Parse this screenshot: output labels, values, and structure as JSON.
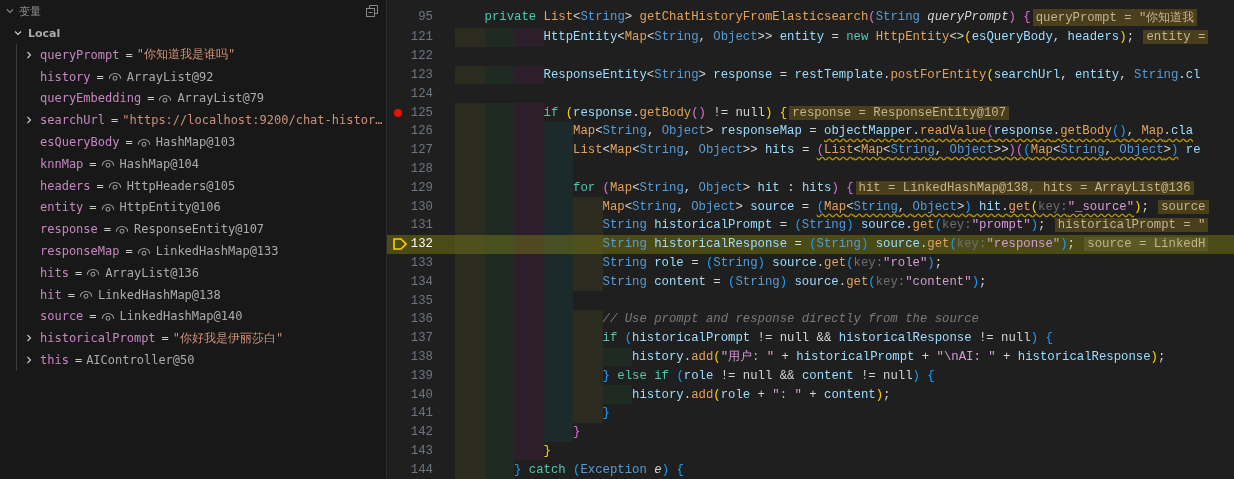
{
  "variables_panel": {
    "title": "变量",
    "scope": {
      "label": "Local",
      "expanded": true
    },
    "variables": [
      {
        "name": "queryPrompt",
        "operator": "=",
        "value": "\"你知道我是谁吗\"",
        "kind": "string",
        "expandable": true
      },
      {
        "name": "history",
        "operator": "=",
        "value": "ArrayList@92",
        "kind": "object",
        "expandable": false
      },
      {
        "name": "queryEmbedding",
        "operator": "=",
        "value": "ArrayList@79",
        "kind": "object",
        "expandable": false
      },
      {
        "name": "searchUrl",
        "operator": "=",
        "value": "\"https://localhost:9200/chat-histor…",
        "kind": "string",
        "expandable": true
      },
      {
        "name": "esQueryBody",
        "operator": "=",
        "value": "HashMap@103",
        "kind": "object",
        "expandable": false
      },
      {
        "name": "knnMap",
        "operator": "=",
        "value": "HashMap@104",
        "kind": "object",
        "expandable": false
      },
      {
        "name": "headers",
        "operator": "=",
        "value": "HttpHeaders@105",
        "kind": "object",
        "expandable": false
      },
      {
        "name": "entity",
        "operator": "=",
        "value": "HttpEntity@106",
        "kind": "object",
        "expandable": false
      },
      {
        "name": "response",
        "operator": "=",
        "value": "ResponseEntity@107",
        "kind": "object",
        "expandable": false
      },
      {
        "name": "responseMap",
        "operator": "=",
        "value": "LinkedHashMap@133",
        "kind": "object",
        "expandable": false
      },
      {
        "name": "hits",
        "operator": "=",
        "value": "ArrayList@136",
        "kind": "object",
        "expandable": false
      },
      {
        "name": "hit",
        "operator": "=",
        "value": "LinkedHashMap@138",
        "kind": "object",
        "expandable": false
      },
      {
        "name": "source",
        "operator": "=",
        "value": "LinkedHashMap@140",
        "kind": "object",
        "expandable": false
      },
      {
        "name": "historicalPrompt",
        "operator": "=",
        "value": "\"你好我是伊丽莎白\"",
        "kind": "string",
        "expandable": true
      },
      {
        "name": "this",
        "operator": "=",
        "value": "AIController@50",
        "kind": "plain",
        "expandable": true
      }
    ]
  },
  "editor": {
    "sticky_line": {
      "number": "95",
      "tokens": [
        {
          "kind": "kw",
          "text": "    private "
        },
        {
          "kind": "generic",
          "text": "List"
        },
        {
          "kind": "plain",
          "text": "<"
        },
        {
          "kind": "type",
          "text": "String"
        },
        {
          "kind": "plain",
          "text": "> "
        },
        {
          "kind": "fn",
          "text": "getChatHistoryFromElasticsearch"
        },
        {
          "kind": "b2",
          "text": "("
        },
        {
          "kind": "type",
          "text": "String "
        },
        {
          "kind": "param",
          "text": "queryPrompt"
        },
        {
          "kind": "b2",
          "text": ") {"
        }
      ],
      "inline": "queryPrompt = \"你知道我"
    },
    "lines": [
      {
        "number": "121",
        "breakpoint": false,
        "current": false,
        "guides": [
          {
            "color": "#2b2b1f"
          },
          {
            "color": "#1f2a22"
          },
          {
            "color": "#2c1f2b"
          }
        ],
        "tokens": [
          {
            "kind": "var",
            "text": "HttpEntity"
          },
          {
            "kind": "plain",
            "text": "<"
          },
          {
            "kind": "generic",
            "text": "Map"
          },
          {
            "kind": "plain",
            "text": "<"
          },
          {
            "kind": "type",
            "text": "String"
          },
          {
            "kind": "plain",
            "text": ", "
          },
          {
            "kind": "type",
            "text": "Object"
          },
          {
            "kind": "plain",
            "text": ">> "
          },
          {
            "kind": "var",
            "text": "entity"
          },
          {
            "kind": "plain",
            "text": " = "
          },
          {
            "kind": "kw",
            "text": "new "
          },
          {
            "kind": "fn",
            "text": "HttpEntity"
          },
          {
            "kind": "plain",
            "text": "<>"
          },
          {
            "kind": "b1",
            "text": "("
          },
          {
            "kind": "var",
            "text": "esQueryBody"
          },
          {
            "kind": "plain",
            "text": ", "
          },
          {
            "kind": "var",
            "text": "headers"
          },
          {
            "kind": "b1",
            "text": ")"
          },
          {
            "kind": "plain",
            "text": "; "
          }
        ],
        "inline": "entity ="
      },
      {
        "number": "122",
        "breakpoint": false,
        "current": false
      },
      {
        "number": "123",
        "breakpoint": false,
        "current": false,
        "guides": [
          {
            "color": "#2b2b1f"
          },
          {
            "color": "#1f2a22"
          },
          {
            "color": "#2c1f2b"
          }
        ],
        "tokens": [
          {
            "kind": "var",
            "text": "ResponseEntity"
          },
          {
            "kind": "plain",
            "text": "<"
          },
          {
            "kind": "type",
            "text": "String"
          },
          {
            "kind": "plain",
            "text": "> "
          },
          {
            "kind": "var",
            "text": "response"
          },
          {
            "kind": "plain",
            "text": " = "
          },
          {
            "kind": "var",
            "text": "restTemplate"
          },
          {
            "kind": "plain",
            "text": "."
          },
          {
            "kind": "fn",
            "text": "postForEntity"
          },
          {
            "kind": "b1",
            "text": "("
          },
          {
            "kind": "var",
            "text": "searchUrl"
          },
          {
            "kind": "plain",
            "text": ", "
          },
          {
            "kind": "var",
            "text": "entity"
          },
          {
            "kind": "plain",
            "text": ", "
          },
          {
            "kind": "type",
            "text": "String"
          },
          {
            "kind": "plain",
            "text": "."
          },
          {
            "kind": "var",
            "text": "cl"
          }
        ]
      },
      {
        "number": "124",
        "breakpoint": false,
        "current": false
      },
      {
        "number": "125",
        "breakpoint": true,
        "current": false,
        "guides": [
          {
            "color": "#2b2b1f"
          },
          {
            "color": "#1f2a22"
          },
          {
            "color": "#2c1f2b"
          }
        ],
        "tokens": [
          {
            "kind": "kw",
            "text": "if "
          },
          {
            "kind": "b1",
            "text": "("
          },
          {
            "kind": "var",
            "text": "response"
          },
          {
            "kind": "plain",
            "text": "."
          },
          {
            "kind": "fn",
            "text": "getBody"
          },
          {
            "kind": "b2",
            "text": "()"
          },
          {
            "kind": "plain",
            "text": " != null"
          },
          {
            "kind": "b1",
            "text": ") {"
          }
        ],
        "inline": "response = ResponseEntity@107"
      },
      {
        "number": "126",
        "breakpoint": false,
        "current": false,
        "guides": [
          {
            "color": "#2b2b1f"
          },
          {
            "color": "#1f2a22"
          },
          {
            "color": "#2c1f2b"
          },
          {
            "color": "#1d2a2b"
          }
        ],
        "tokens": [
          {
            "kind": "generic",
            "text": "Map"
          },
          {
            "kind": "plain",
            "text": "<"
          },
          {
            "kind": "type",
            "text": "String"
          },
          {
            "kind": "plain",
            "text": ", "
          },
          {
            "kind": "type",
            "text": "Object"
          },
          {
            "kind": "plain",
            "text": "> "
          },
          {
            "kind": "var",
            "text": "responseMap"
          },
          {
            "kind": "plain",
            "text": " = "
          },
          {
            "kind": "var",
            "text": "objectMapper",
            "warn": true
          },
          {
            "kind": "plain",
            "text": ".",
            "warn": true
          },
          {
            "kind": "fn",
            "text": "readValue",
            "warn": true
          },
          {
            "kind": "b2",
            "text": "(",
            "warn": true
          },
          {
            "kind": "var",
            "text": "response",
            "warn": true
          },
          {
            "kind": "plain",
            "text": ".",
            "warn": true
          },
          {
            "kind": "fn",
            "text": "getBody",
            "warn": true
          },
          {
            "kind": "b3",
            "text": "()",
            "warn": true
          },
          {
            "kind": "plain",
            "text": ", ",
            "warn": true
          },
          {
            "kind": "generic",
            "text": "Map",
            "warn": true
          },
          {
            "kind": "plain",
            "text": ".",
            "warn": true
          },
          {
            "kind": "var",
            "text": "cla",
            "warn": true
          }
        ]
      },
      {
        "number": "127",
        "breakpoint": false,
        "current": false,
        "guides": [
          {
            "color": "#2b2b1f"
          },
          {
            "color": "#1f2a22"
          },
          {
            "color": "#2c1f2b"
          },
          {
            "color": "#1d2a2b"
          }
        ],
        "tokens": [
          {
            "kind": "generic",
            "text": "List"
          },
          {
            "kind": "plain",
            "text": "<"
          },
          {
            "kind": "generic",
            "text": "Map"
          },
          {
            "kind": "plain",
            "text": "<"
          },
          {
            "kind": "type",
            "text": "String"
          },
          {
            "kind": "plain",
            "text": ", "
          },
          {
            "kind": "type",
            "text": "Object"
          },
          {
            "kind": "plain",
            "text": ">> "
          },
          {
            "kind": "var",
            "text": "hits"
          },
          {
            "kind": "plain",
            "text": " = "
          },
          {
            "kind": "b2",
            "text": "(",
            "warn": true
          },
          {
            "kind": "generic",
            "text": "List",
            "warn": true
          },
          {
            "kind": "plain",
            "text": "<",
            "warn": true
          },
          {
            "kind": "generic",
            "text": "Map",
            "warn": true
          },
          {
            "kind": "plain",
            "text": "<",
            "warn": true
          },
          {
            "kind": "type",
            "text": "String",
            "warn": true
          },
          {
            "kind": "plain",
            "text": ", ",
            "warn": true
          },
          {
            "kind": "type",
            "text": "Object",
            "warn": true
          },
          {
            "kind": "plain",
            "text": ">>",
            "warn": true
          },
          {
            "kind": "b2",
            "text": ")(",
            "warn": true
          },
          {
            "kind": "b3",
            "text": "(",
            "warn": true
          },
          {
            "kind": "generic",
            "text": "Map",
            "warn": true
          },
          {
            "kind": "plain",
            "text": "<",
            "warn": true
          },
          {
            "kind": "type",
            "text": "String",
            "warn": true
          },
          {
            "kind": "plain",
            "text": ", ",
            "warn": true
          },
          {
            "kind": "type",
            "text": "Object",
            "warn": true
          },
          {
            "kind": "plain",
            "text": ">",
            "warn": true
          },
          {
            "kind": "b3",
            "text": ")",
            "warn": true
          },
          {
            "kind": "var",
            "text": " re"
          }
        ]
      },
      {
        "number": "128",
        "breakpoint": false,
        "current": false,
        "guides": [
          {
            "color": "#2b2b1f"
          },
          {
            "color": "#1f2a22"
          },
          {
            "color": "#2c1f2b"
          },
          {
            "color": "#1d2a2b"
          }
        ]
      },
      {
        "number": "129",
        "breakpoint": false,
        "current": false,
        "guides": [
          {
            "color": "#2b2b1f"
          },
          {
            "color": "#1f2a22"
          },
          {
            "color": "#2c1f2b"
          },
          {
            "color": "#1d2a2b"
          }
        ],
        "tokens": [
          {
            "kind": "kw",
            "text": "for "
          },
          {
            "kind": "b2",
            "text": "("
          },
          {
            "kind": "generic",
            "text": "Map"
          },
          {
            "kind": "plain",
            "text": "<"
          },
          {
            "kind": "type",
            "text": "String"
          },
          {
            "kind": "plain",
            "text": ", "
          },
          {
            "kind": "type",
            "text": "Object"
          },
          {
            "kind": "plain",
            "text": "> "
          },
          {
            "kind": "var",
            "text": "hit"
          },
          {
            "kind": "plain",
            "text": " : "
          },
          {
            "kind": "var",
            "text": "hits"
          },
          {
            "kind": "b2",
            "text": ") {"
          }
        ],
        "inline": "hit = LinkedHashMap@138, hits = ArrayList@136"
      },
      {
        "number": "130",
        "breakpoint": false,
        "current": false,
        "guides": [
          {
            "color": "#2b2b1f"
          },
          {
            "color": "#1f2a22"
          },
          {
            "color": "#2c1f2b"
          },
          {
            "color": "#1d2a2b"
          },
          {
            "color": "#2b2b1f"
          }
        ],
        "tokens": [
          {
            "kind": "generic",
            "text": "Map"
          },
          {
            "kind": "plain",
            "text": "<"
          },
          {
            "kind": "type",
            "text": "String"
          },
          {
            "kind": "plain",
            "text": ", "
          },
          {
            "kind": "type",
            "text": "Object"
          },
          {
            "kind": "plain",
            "text": "> "
          },
          {
            "kind": "var",
            "text": "source"
          },
          {
            "kind": "plain",
            "text": " = "
          },
          {
            "kind": "b3",
            "text": "(",
            "warn": true
          },
          {
            "kind": "generic",
            "text": "Map",
            "warn": true
          },
          {
            "kind": "plain",
            "text": "<",
            "warn": true
          },
          {
            "kind": "type",
            "text": "String",
            "warn": true
          },
          {
            "kind": "plain",
            "text": ", ",
            "warn": true
          },
          {
            "kind": "type",
            "text": "Object",
            "warn": true
          },
          {
            "kind": "plain",
            "text": ">",
            "warn": true
          },
          {
            "kind": "b3",
            "text": ")",
            "warn": true
          },
          {
            "kind": "var",
            "text": " hit",
            "warn": true
          },
          {
            "kind": "plain",
            "text": ".",
            "warn": true
          },
          {
            "kind": "fn",
            "text": "get",
            "warn": true
          },
          {
            "kind": "b1",
            "text": "(",
            "warn": true
          },
          {
            "kind": "hint",
            "text": "key:",
            "warn": true
          },
          {
            "kind": "str",
            "text": "\"_source\"",
            "warn": true
          },
          {
            "kind": "b1",
            "text": ")"
          },
          {
            "kind": "plain",
            "text": "; "
          }
        ],
        "inline": "source"
      },
      {
        "number": "131",
        "breakpoint": false,
        "current": false,
        "guides": [
          {
            "color": "#2b2b1f"
          },
          {
            "color": "#1f2a22"
          },
          {
            "color": "#2c1f2b"
          },
          {
            "color": "#1d2a2b"
          },
          {
            "color": "#2b2b1f"
          }
        ],
        "tokens": [
          {
            "kind": "type",
            "text": "String "
          },
          {
            "kind": "var",
            "text": "historicalPrompt"
          },
          {
            "kind": "plain",
            "text": " = "
          },
          {
            "kind": "b3",
            "text": "("
          },
          {
            "kind": "type",
            "text": "String"
          },
          {
            "kind": "b3",
            "text": ")"
          },
          {
            "kind": "var",
            "text": " source"
          },
          {
            "kind": "plain",
            "text": "."
          },
          {
            "kind": "fn",
            "text": "get"
          },
          {
            "kind": "b3",
            "text": "("
          },
          {
            "kind": "hint",
            "text": "key:"
          },
          {
            "kind": "str",
            "text": "\"prompt\""
          },
          {
            "kind": "b3",
            "text": ")"
          },
          {
            "kind": "plain",
            "text": "; "
          }
        ],
        "inline": "historicalPrompt = \""
      },
      {
        "number": "132",
        "breakpoint": false,
        "current": true,
        "guides": [
          {
            "color": "#50501c"
          },
          {
            "color": "#48501e"
          },
          {
            "color": "#504820"
          },
          {
            "color": "#484f22"
          },
          {
            "color": "#50501c"
          }
        ],
        "tokens": [
          {
            "kind": "type",
            "text": "String "
          },
          {
            "kind": "var",
            "text": "historicalResponse"
          },
          {
            "kind": "plain",
            "text": " = "
          },
          {
            "kind": "b3",
            "text": "("
          },
          {
            "kind": "type",
            "text": "String"
          },
          {
            "kind": "b3",
            "text": ")"
          },
          {
            "kind": "var",
            "text": " source"
          },
          {
            "kind": "plain",
            "text": "."
          },
          {
            "kind": "fn",
            "text": "get"
          },
          {
            "kind": "b3",
            "text": "("
          },
          {
            "kind": "hint",
            "text": "key:"
          },
          {
            "kind": "str",
            "text": "\"response\""
          },
          {
            "kind": "b3",
            "text": ")"
          },
          {
            "kind": "plain",
            "text": "; "
          }
        ],
        "inline": "source = LinkedH"
      },
      {
        "number": "133",
        "breakpoint": false,
        "current": false,
        "guides": [
          {
            "color": "#2b2b1f"
          },
          {
            "color": "#1f2a22"
          },
          {
            "color": "#2c1f2b"
          },
          {
            "color": "#1d2a2b"
          },
          {
            "color": "#2b2b1f"
          }
        ],
        "tokens": [
          {
            "kind": "type",
            "text": "String "
          },
          {
            "kind": "var",
            "text": "role"
          },
          {
            "kind": "plain",
            "text": " = "
          },
          {
            "kind": "b3",
            "text": "("
          },
          {
            "kind": "type",
            "text": "String"
          },
          {
            "kind": "b3",
            "text": ")"
          },
          {
            "kind": "var",
            "text": " source"
          },
          {
            "kind": "plain",
            "text": "."
          },
          {
            "kind": "fn",
            "text": "get"
          },
          {
            "kind": "b3",
            "text": "("
          },
          {
            "kind": "hint",
            "text": "key:"
          },
          {
            "kind": "str",
            "text": "\"role\""
          },
          {
            "kind": "b3",
            "text": ")"
          },
          {
            "kind": "plain",
            "text": ";"
          }
        ]
      },
      {
        "number": "134",
        "breakpoint": false,
        "current": false,
        "guides": [
          {
            "color": "#2b2b1f"
          },
          {
            "color": "#1f2a22"
          },
          {
            "color": "#2c1f2b"
          },
          {
            "color": "#1d2a2b"
          },
          {
            "color": "#2b2b1f"
          }
        ],
        "tokens": [
          {
            "kind": "type",
            "text": "String "
          },
          {
            "kind": "var",
            "text": "content"
          },
          {
            "kind": "plain",
            "text": " = "
          },
          {
            "kind": "b3",
            "text": "("
          },
          {
            "kind": "type",
            "text": "String"
          },
          {
            "kind": "b3",
            "text": ")"
          },
          {
            "kind": "var",
            "text": " source"
          },
          {
            "kind": "plain",
            "text": "."
          },
          {
            "kind": "fn",
            "text": "get"
          },
          {
            "kind": "b3",
            "text": "("
          },
          {
            "kind": "hint",
            "text": "key:"
          },
          {
            "kind": "str",
            "text": "\"content\""
          },
          {
            "kind": "b3",
            "text": ")"
          },
          {
            "kind": "plain",
            "text": ";"
          }
        ]
      },
      {
        "number": "135",
        "breakpoint": false,
        "current": false,
        "guides": [
          {
            "color": "#2b2b1f"
          },
          {
            "color": "#1f2a22"
          },
          {
            "color": "#2c1f2b"
          },
          {
            "color": "#1d2a2b"
          }
        ]
      },
      {
        "number": "136",
        "breakpoint": false,
        "current": false,
        "guides": [
          {
            "color": "#2b2b1f"
          },
          {
            "color": "#1f2a22"
          },
          {
            "color": "#2c1f2b"
          },
          {
            "color": "#1d2a2b"
          },
          {
            "color": "#2b2b1f"
          }
        ],
        "tokens": [
          {
            "kind": "comment",
            "text": "// Use prompt and response directly from the source"
          }
        ]
      },
      {
        "number": "137",
        "breakpoint": false,
        "current": false,
        "guides": [
          {
            "color": "#2b2b1f"
          },
          {
            "color": "#1f2a22"
          },
          {
            "color": "#2c1f2b"
          },
          {
            "color": "#1d2a2b"
          },
          {
            "color": "#2b2b1f"
          }
        ],
        "tokens": [
          {
            "kind": "kw",
            "text": "if "
          },
          {
            "kind": "b3",
            "text": "("
          },
          {
            "kind": "var",
            "text": "historicalPrompt"
          },
          {
            "kind": "plain",
            "text": " != null && "
          },
          {
            "kind": "var",
            "text": "historicalResponse"
          },
          {
            "kind": "plain",
            "text": " != null"
          },
          {
            "kind": "b3",
            "text": ") {"
          }
        ]
      },
      {
        "number": "138",
        "breakpoint": false,
        "current": false,
        "guides": [
          {
            "color": "#2b2b1f"
          },
          {
            "color": "#1f2a22"
          },
          {
            "color": "#2c1f2b"
          },
          {
            "color": "#1d2a2b"
          },
          {
            "color": "#2b2b1f"
          },
          {
            "color": "#1f2a22"
          }
        ],
        "tokens": [
          {
            "kind": "var",
            "text": "history"
          },
          {
            "kind": "plain",
            "text": "."
          },
          {
            "kind": "fn",
            "text": "add"
          },
          {
            "kind": "b1",
            "text": "("
          },
          {
            "kind": "str",
            "text": "\"用户: \""
          },
          {
            "kind": "plain",
            "text": " + "
          },
          {
            "kind": "var",
            "text": "historicalPrompt"
          },
          {
            "kind": "plain",
            "text": " + "
          },
          {
            "kind": "str",
            "text": "\"\\nAI: \""
          },
          {
            "kind": "plain",
            "text": " + "
          },
          {
            "kind": "var",
            "text": "historicalResponse"
          },
          {
            "kind": "b1",
            "text": ")"
          },
          {
            "kind": "plain",
            "text": ";"
          }
        ]
      },
      {
        "number": "139",
        "breakpoint": false,
        "current": false,
        "guides": [
          {
            "color": "#2b2b1f"
          },
          {
            "color": "#1f2a22"
          },
          {
            "color": "#2c1f2b"
          },
          {
            "color": "#1d2a2b"
          },
          {
            "color": "#2b2b1f"
          }
        ],
        "tokens": [
          {
            "kind": "b3",
            "text": "}"
          },
          {
            "kind": "kw",
            "text": " else if "
          },
          {
            "kind": "b3",
            "text": "("
          },
          {
            "kind": "var",
            "text": "role"
          },
          {
            "kind": "plain",
            "text": " != null && "
          },
          {
            "kind": "var",
            "text": "content"
          },
          {
            "kind": "plain",
            "text": " != null"
          },
          {
            "kind": "b3",
            "text": ") {"
          }
        ]
      },
      {
        "number": "140",
        "breakpoint": false,
        "current": false,
        "guides": [
          {
            "color": "#2b2b1f"
          },
          {
            "color": "#1f2a22"
          },
          {
            "color": "#2c1f2b"
          },
          {
            "color": "#1d2a2b"
          },
          {
            "color": "#2b2b1f"
          },
          {
            "color": "#1f2a22"
          }
        ],
        "tokens": [
          {
            "kind": "var",
            "text": "history"
          },
          {
            "kind": "plain",
            "text": "."
          },
          {
            "kind": "fn",
            "text": "add"
          },
          {
            "kind": "b1",
            "text": "("
          },
          {
            "kind": "var",
            "text": "role"
          },
          {
            "kind": "plain",
            "text": " + "
          },
          {
            "kind": "str",
            "text": "\": \""
          },
          {
            "kind": "plain",
            "text": " + "
          },
          {
            "kind": "var",
            "text": "content"
          },
          {
            "kind": "b1",
            "text": ")"
          },
          {
            "kind": "plain",
            "text": ";"
          }
        ]
      },
      {
        "number": "141",
        "breakpoint": false,
        "current": false,
        "guides": [
          {
            "color": "#2b2b1f"
          },
          {
            "color": "#1f2a22"
          },
          {
            "color": "#2c1f2b"
          },
          {
            "color": "#1d2a2b"
          },
          {
            "color": "#2b2b1f"
          }
        ],
        "tokens": [
          {
            "kind": "b3",
            "text": "}"
          }
        ]
      },
      {
        "number": "142",
        "breakpoint": false,
        "current": false,
        "guides": [
          {
            "color": "#2b2b1f"
          },
          {
            "color": "#1f2a22"
          },
          {
            "color": "#2c1f2b"
          },
          {
            "color": "#1d2a2b"
          }
        ],
        "tokens": [
          {
            "kind": "b2",
            "text": "}"
          }
        ]
      },
      {
        "number": "143",
        "breakpoint": false,
        "current": false,
        "guides": [
          {
            "color": "#2b2b1f"
          },
          {
            "color": "#1f2a22"
          },
          {
            "color": "#2c1f2b"
          }
        ],
        "tokens": [
          {
            "kind": "b1",
            "text": "}"
          }
        ]
      },
      {
        "number": "144",
        "breakpoint": false,
        "current": false,
        "guides": [
          {
            "color": "#2b2b1f"
          },
          {
            "color": "#1f2a22"
          }
        ],
        "tokens": [
          {
            "kind": "b3",
            "text": "}"
          },
          {
            "kind": "kw",
            "text": " catch "
          },
          {
            "kind": "b3",
            "text": "("
          },
          {
            "kind": "type",
            "text": "Exception "
          },
          {
            "kind": "param",
            "text": "e"
          },
          {
            "kind": "b3",
            "text": ") {"
          }
        ]
      }
    ]
  }
}
